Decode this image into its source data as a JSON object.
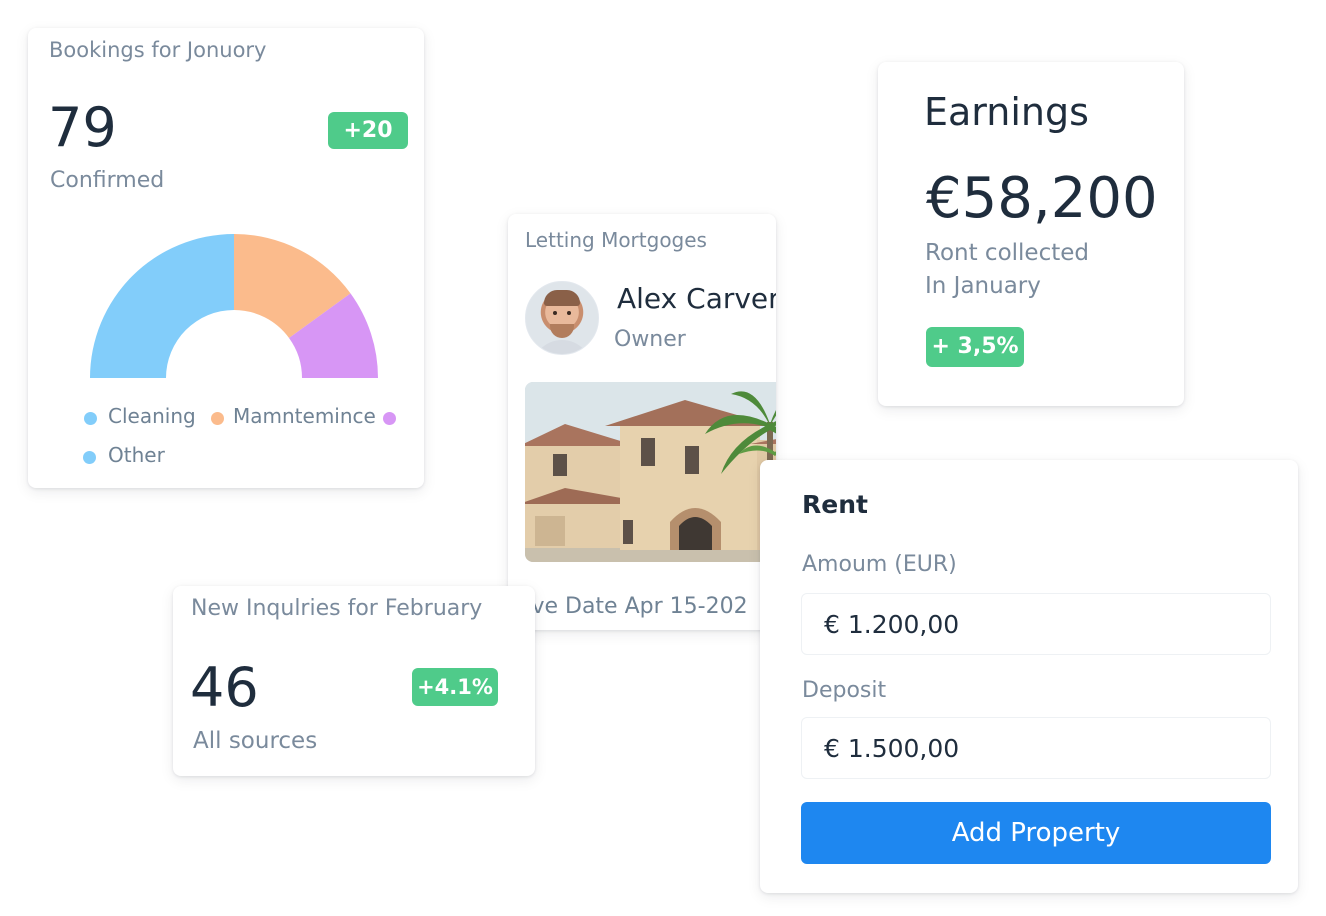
{
  "bookings": {
    "title": "Bookings for Jonuory",
    "count": "79",
    "label": "Confirmed",
    "badge": "+20",
    "chart_data": {
      "type": "pie",
      "title": "",
      "categories": [
        "Cleaning",
        "Mamntemince",
        "",
        "Other"
      ],
      "values": [
        50,
        30,
        20
      ],
      "colors": [
        "#82cdfa",
        "#fbbb8c",
        "#d796f5"
      ]
    },
    "legend": [
      {
        "label": "Cleaning",
        "color": "#82cdfa"
      },
      {
        "label": "Mamntemince",
        "color": "#fbbb8c"
      },
      {
        "label": "",
        "color": "#d796f5"
      },
      {
        "label": "Other",
        "color": "#82cdfa"
      }
    ]
  },
  "letting": {
    "title": "Letting Mortgoges",
    "owner_name": "Alex Carver",
    "owner_role": "Owner",
    "date": "ove Date  Apr 15-202"
  },
  "earnings": {
    "title": "Earnings",
    "amount": "€58,200",
    "sub1": "Ront collected",
    "sub2": "In January",
    "badge": "+ 3,5%"
  },
  "inquiries": {
    "title": "New Inqulries for February",
    "count": "46",
    "label": "All sources",
    "badge": "+4.1%"
  },
  "rent": {
    "title": "Rent",
    "amount_label": "Amoum  (EUR)",
    "amount_value": "€ 1.200,00",
    "deposit_label": "Deposit",
    "deposit_value": "€ 1.500,00",
    "button": "Add Property"
  }
}
